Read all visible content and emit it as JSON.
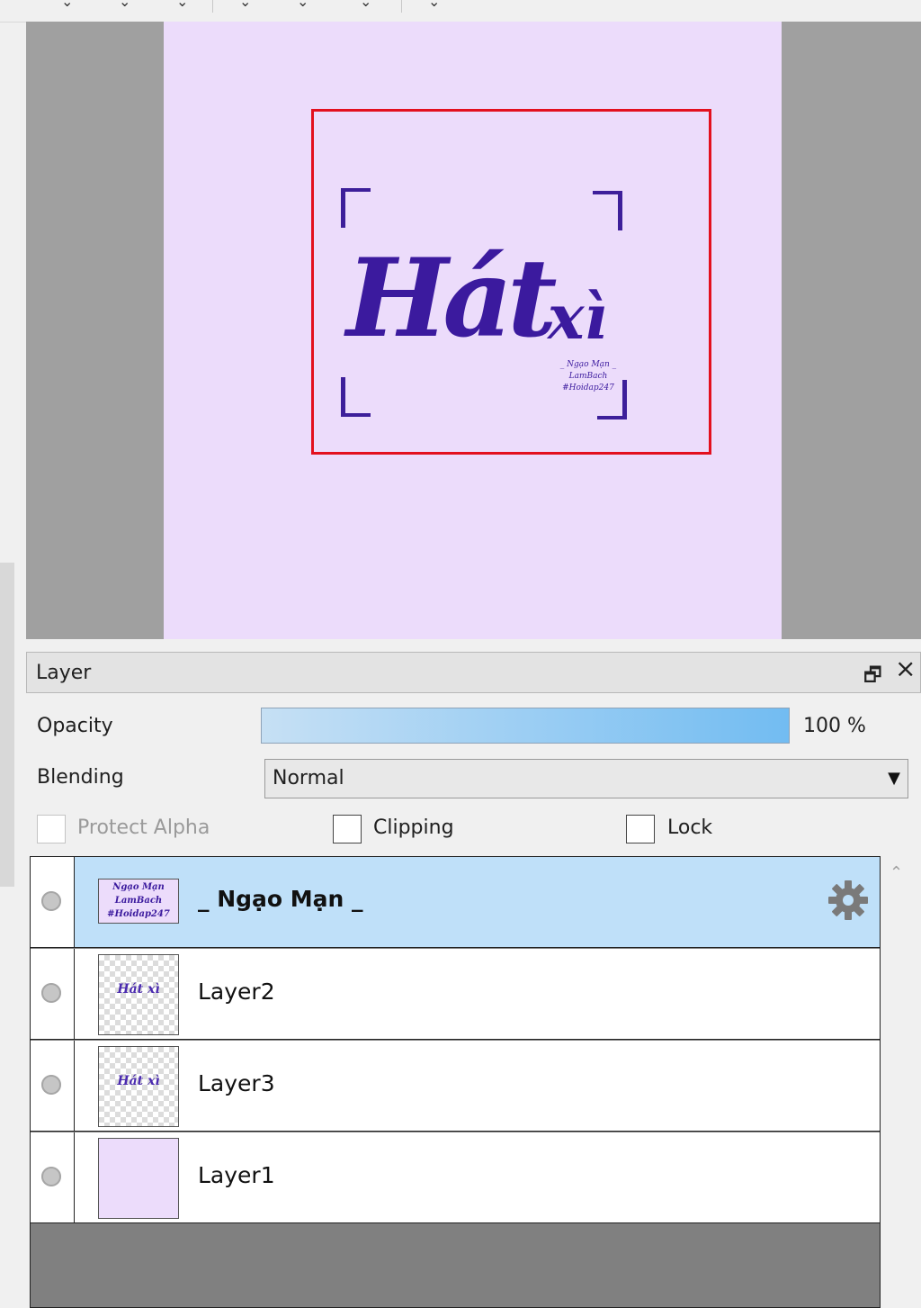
{
  "canvas": {
    "artwork_title": "Hát",
    "artwork_word": "xì",
    "artwork_signature": [
      "_ Ngạo Mạn _",
      "LamBach",
      "#Hoidap247"
    ]
  },
  "layer_panel": {
    "title": "Layer",
    "opacity_label": "Opacity",
    "opacity_value": 100,
    "opacity_text": "100 %",
    "blending_label": "Blending",
    "blending_value": "Normal",
    "checkboxes": {
      "protect_alpha": "Protect Alpha",
      "clipping": "Clipping",
      "lock": "Lock"
    },
    "layers": [
      {
        "name": "_ Ngạo Mạn _",
        "selected": true,
        "thumb_lines": [
          "Ngạo Mạn",
          "LamBach",
          "#Hoidap247"
        ]
      },
      {
        "name": "Layer2",
        "selected": false,
        "thumb_text": "Hát xì"
      },
      {
        "name": "Layer3",
        "selected": false,
        "thumb_text": "Hát xì"
      },
      {
        "name": "Layer1",
        "selected": false
      }
    ]
  },
  "colors": {
    "canvas_bg": "#ecdcfb",
    "ink": "#3b1a9e",
    "selection": "#e3101e",
    "selected_row": "#bfe0f9"
  }
}
